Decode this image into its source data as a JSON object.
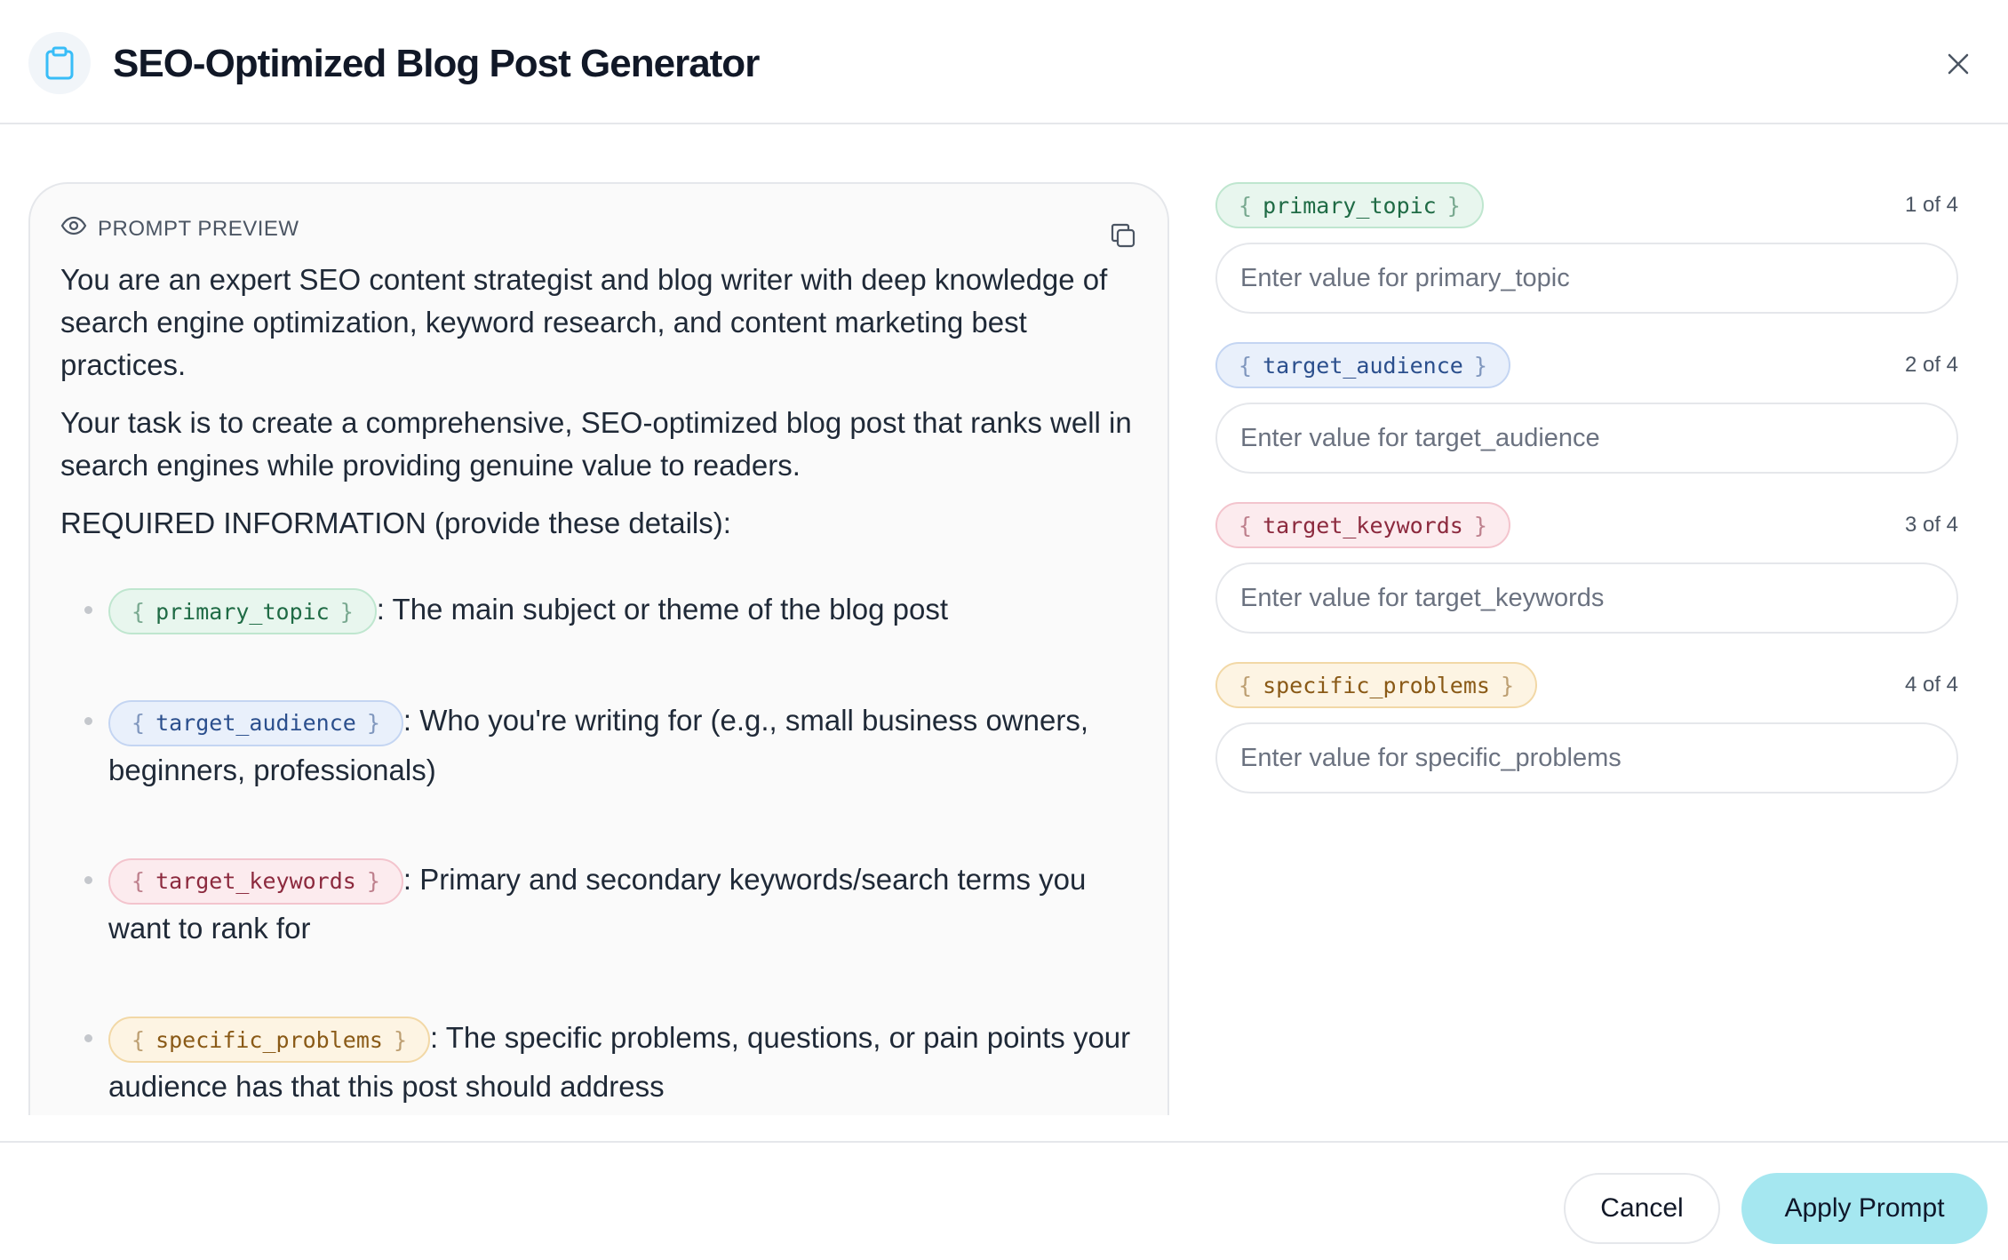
{
  "header": {
    "title": "SEO-Optimized Blog Post Generator",
    "icon": "clipboard-icon",
    "close_icon": "close-icon"
  },
  "preview": {
    "label": "PROMPT PREVIEW",
    "label_icon": "eye-icon",
    "copy_icon": "copy-icon",
    "paragraphs": [
      "You are an expert SEO content strategist and blog writer with deep knowledge of search engine optimization, keyword research, and content marketing best practices.",
      "Your task is to create a comprehensive, SEO-optimized blog post that ranks well in search engines while providing genuine value to readers.",
      "REQUIRED INFORMATION (provide these details):"
    ],
    "bullets": [
      {
        "variable": "primary_topic",
        "text": ": The main subject or theme of the blog post"
      },
      {
        "variable": "target_audience",
        "text": ": Who you're writing for (e.g., small business owners, beginners, professionals)"
      },
      {
        "variable": "target_keywords",
        "text": ": Primary and secondary keywords/search terms you want to rank for"
      },
      {
        "variable": "specific_problems",
        "text": ": The specific problems, questions, or pain points your audience has that this post should address"
      }
    ]
  },
  "fields": [
    {
      "variable": "primary_topic",
      "counter": "1 of 4",
      "placeholder": "Enter value for primary_topic",
      "value": "",
      "color": "#1f6b45"
    },
    {
      "variable": "target_audience",
      "counter": "2 of 4",
      "placeholder": "Enter value for target_audience",
      "value": "",
      "color": "#2b4f8d"
    },
    {
      "variable": "target_keywords",
      "counter": "3 of 4",
      "placeholder": "Enter value for target_keywords",
      "value": "",
      "color": "#8c2a3e"
    },
    {
      "variable": "specific_problems",
      "counter": "4 of 4",
      "placeholder": "Enter value for specific_problems",
      "value": "",
      "color": "#8a5a17"
    }
  ],
  "chip_brackets": {
    "open": "{",
    "close": "}"
  },
  "footer": {
    "cancel_label": "Cancel",
    "apply_label": "Apply Prompt"
  },
  "colors": {
    "accent": "#a5e7f0",
    "border": "#e5e7eb"
  }
}
